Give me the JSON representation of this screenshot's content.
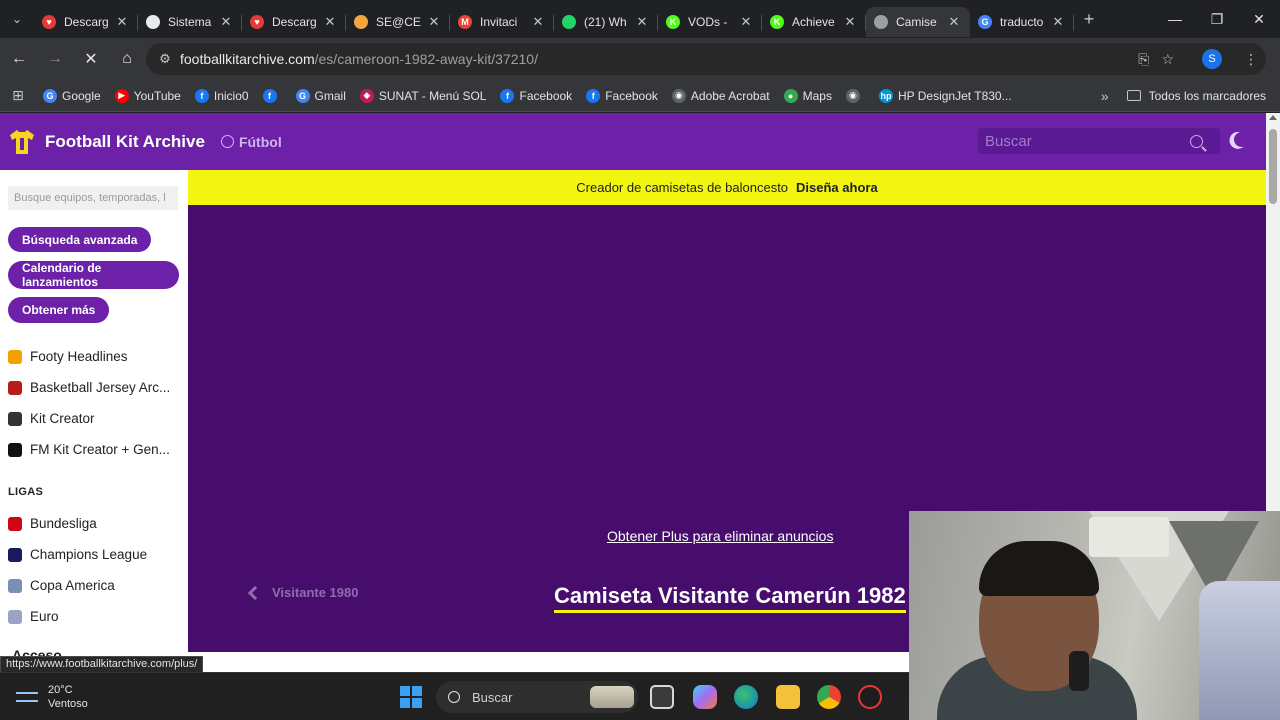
{
  "browser": {
    "tabs": [
      {
        "title": "Descarg",
        "fav_color": "#e53935",
        "fav_glyph": "♥",
        "active": false
      },
      {
        "title": "Sistema",
        "fav_color": "#e8eaed",
        "fav_glyph": "",
        "active": false
      },
      {
        "title": "Descarg",
        "fav_color": "#e53935",
        "fav_glyph": "♥",
        "active": false
      },
      {
        "title": "SE@CE",
        "fav_color": "#f4a640",
        "fav_glyph": "",
        "active": false
      },
      {
        "title": "Invitaci",
        "fav_color": "#ea4335",
        "fav_glyph": "M",
        "active": false
      },
      {
        "title": "(21) Wh",
        "fav_color": "#25d366",
        "fav_glyph": "",
        "active": false
      },
      {
        "title": "VODs -",
        "fav_color": "#53fc18",
        "fav_glyph": "K",
        "active": false
      },
      {
        "title": "Achieve",
        "fav_color": "#53fc18",
        "fav_glyph": "K",
        "active": false
      },
      {
        "title": "Camise",
        "fav_color": "#9aa0a6",
        "fav_glyph": "",
        "active": true
      },
      {
        "title": "traducto",
        "fav_color": "#4285f4",
        "fav_glyph": "G",
        "active": false
      }
    ],
    "url_domain": "footballkitarchive.com",
    "url_path": "/es/cameroon-1982-away-kit/37210/",
    "profile_initial": "S",
    "bookmarks": [
      {
        "label": "Google",
        "color": "#4285f4",
        "glyph": "G"
      },
      {
        "label": "YouTube",
        "color": "#ff0000",
        "glyph": "▶"
      },
      {
        "label": "Inicio0",
        "color": "#1877f2",
        "glyph": "f"
      },
      {
        "label": "",
        "color": "#1877f2",
        "glyph": "f"
      },
      {
        "label": "Gmail",
        "color": "#4285f4",
        "glyph": "G"
      },
      {
        "label": "SUNAT - Menú SOL",
        "color": "#c2185b",
        "glyph": "◆"
      },
      {
        "label": "Facebook",
        "color": "#1877f2",
        "glyph": "f"
      },
      {
        "label": "Facebook",
        "color": "#1877f2",
        "glyph": "f"
      },
      {
        "label": "Adobe Acrobat",
        "color": "#5f6368",
        "glyph": "◉"
      },
      {
        "label": "Maps",
        "color": "#34a853",
        "glyph": "●"
      },
      {
        "label": "",
        "color": "#5f6368",
        "glyph": "◉"
      },
      {
        "label": "HP DesignJet T830...",
        "color": "#0096d6",
        "glyph": "hp"
      }
    ],
    "all_bookmarks_label": "Todos los marcadores"
  },
  "site": {
    "logo_text": "Football Kit Archive",
    "sport_label": "Fútbol",
    "search_placeholder": "Buscar",
    "sidebar": {
      "search_placeholder": "Busque equipos, temporadas, l",
      "buttons": [
        "Búsqueda avanzada",
        "Calendario de lanzamientos",
        "Obtener más"
      ],
      "links": [
        {
          "label": "Footy Headlines",
          "icon": "footy-headlines-icon",
          "color": "#f2a100"
        },
        {
          "label": "Basketball Jersey Arc...",
          "icon": "basketball-jersey-icon",
          "color": "#b71c1c"
        },
        {
          "label": "Kit Creator",
          "icon": "shirt-icon",
          "color": "#333333"
        },
        {
          "label": "FM Kit Creator + Gen...",
          "icon": "fm-icon",
          "color": "#111111"
        }
      ],
      "leagues_heading": "LIGAS",
      "leagues": [
        {
          "label": "Bundesliga",
          "icon": "bundesliga-icon",
          "color": "#d20515"
        },
        {
          "label": "Champions League",
          "icon": "champions-league-icon",
          "color": "#1a1a5e"
        },
        {
          "label": "Copa America",
          "icon": "copa-america-icon",
          "color": "#7a8fb5"
        },
        {
          "label": "Euro",
          "icon": "euro-icon",
          "color": "#9aa5c4"
        }
      ],
      "access_heading": "Acceso"
    },
    "promo": {
      "text": "Creador de camisetas de baloncesto",
      "cta": "Diseña ahora"
    },
    "hero": {
      "plus_link": "Obtener Plus para eliminar anuncios",
      "prev_kit": "Visitante 1980",
      "kit_title": "Camiseta Visitante Camerún 1982"
    },
    "status_url": "https://www.footballkitarchive.com/plus/"
  },
  "taskbar": {
    "weather_temp": "20°C",
    "weather_desc": "Ventoso",
    "search_label": "Buscar"
  }
}
